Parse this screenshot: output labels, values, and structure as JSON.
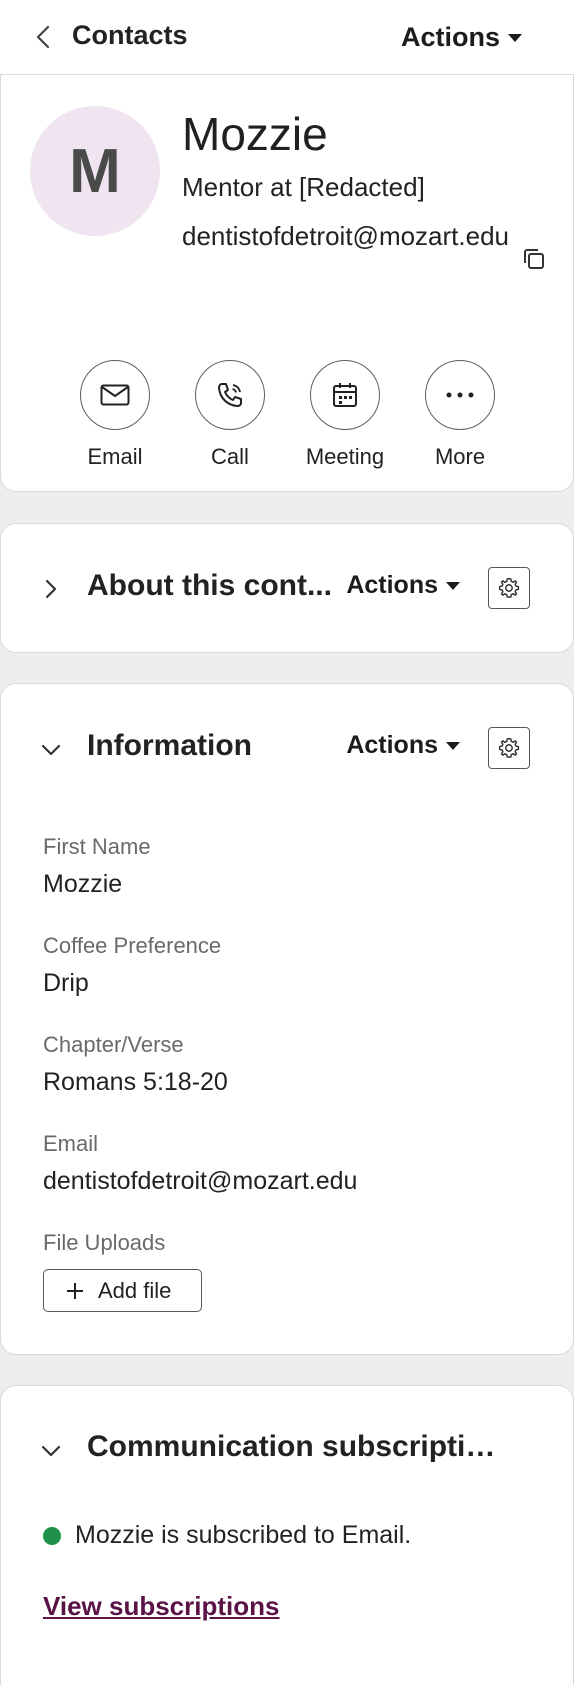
{
  "topbar": {
    "title": "Contacts",
    "actions_label": "Actions"
  },
  "profile": {
    "avatar_initial": "M",
    "name": "Mozzie",
    "subtitle": "Mentor at [Redacted]",
    "email": "dentistofdetroit@mozart.edu"
  },
  "quick_actions": [
    {
      "label": "Email",
      "icon": "envelope-icon"
    },
    {
      "label": "Call",
      "icon": "phone-icon"
    },
    {
      "label": "Meeting",
      "icon": "calendar-icon"
    },
    {
      "label": "More",
      "icon": "ellipsis-icon"
    }
  ],
  "about": {
    "title": "About this cont...",
    "actions_label": "Actions",
    "expanded": false
  },
  "information": {
    "title": "Information",
    "actions_label": "Actions",
    "expanded": true,
    "fields": [
      {
        "label": "First Name",
        "value": "Mozzie"
      },
      {
        "label": "Coffee Preference",
        "value": "Drip"
      },
      {
        "label": "Chapter/Verse",
        "value": "Romans 5:18-20"
      },
      {
        "label": "Email",
        "value": "dentistofdetroit@mozart.edu"
      }
    ],
    "uploads_label": "File Uploads",
    "add_file_label": "Add file"
  },
  "communication": {
    "title": "Communication subscriptio...",
    "expanded": true,
    "status_text": "Mozzie is subscribed to Email.",
    "status_color": "#1f8f4a",
    "link_label": "View subscriptions",
    "link_color": "#5a1346"
  }
}
